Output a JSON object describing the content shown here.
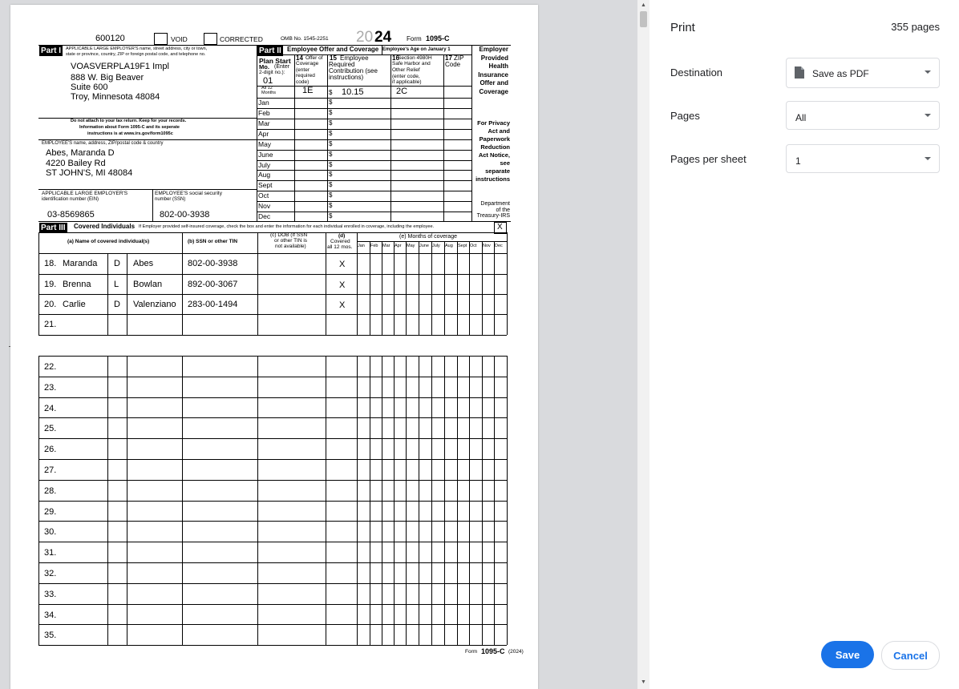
{
  "form": {
    "control_no": "600120",
    "void_label": "VOID",
    "corrected_label": "CORRECTED",
    "omb": "OMB No. 1545-2251",
    "year_prefix": "20",
    "year_suffix": "24",
    "form_label": "Form",
    "form_name": "1095-C",
    "part1_label": "Part I",
    "employer_header": "APPLICABLE LARGE EMPLOYER'S name, street address, city or town,",
    "employer_header2": "state or province, country, ZIP or foreign postal code, and telephone no.",
    "employer_name": "VOASVERPLA19F1 Impl",
    "employer_street": "888 W. Big Beaver",
    "employer_suite": "Suite 600",
    "employer_city": "Troy, Minnesota 48084",
    "notice1": "Do not attach to your tax return. Keep for your records.",
    "notice2": "Information about Form 1095-C and its seperate",
    "notice3": "instructions is at www.irs.gov/form1095c",
    "employee_header": "EMPLOYEE'S name, address, ZIP/postal code & country",
    "employee_name": "Abes, Maranda D",
    "employee_street": "4220 Bailey Rd",
    "employee_city": "ST JOHN'S, MI 48084",
    "ein_header1": "APPLICABLE LARGE EMPLOYER'S",
    "ein_header2": "identification number (EIN)",
    "ein": "03-8569865",
    "ssn_header1": "EMPLOYEE'S social security",
    "ssn_header2": "number (SSN)",
    "ssn": "802-00-3938",
    "part2_label": "Part II",
    "part2_title": "Employee Offer and Coverage",
    "age_label": "Employee's Age on January 1",
    "plan_start_1": "Plan Start",
    "plan_start_2": "Mo.",
    "plan_start_3": "(Enter",
    "plan_start_4": "2-digit no.):",
    "plan_start_value": "01",
    "col14_1": "14",
    "col14_2": "Offer of",
    "col14_3": "Coverage",
    "col14_4": "(enter",
    "col14_5": "required",
    "col14_6": "code)",
    "col15_1": "15",
    "col15_2": "Employee",
    "col15_3": "Required",
    "col15_4": "Contribution (see",
    "col15_5": "instructions)",
    "col16_1": "16",
    "col16_2": "Section 4980H",
    "col16_3": "Safe Harbor and",
    "col16_4": "Other Relief",
    "col16_5": "(enter code,",
    "col16_6": "if applicable)",
    "col17_1": "17",
    "col17_2": "ZIP",
    "col17_3": "Code",
    "all12_1": "All 12",
    "all12_2": "Months",
    "all12_offer": "1E",
    "dollar": "$",
    "all12_contribution": "10.15",
    "all12_safe_harbor": "2C",
    "months": [
      "Jan",
      "Feb",
      "Mar",
      "Apr",
      "May",
      "June",
      "July",
      "Aug",
      "Sept",
      "Oct",
      "Nov",
      "Dec"
    ],
    "side1": [
      "Employer",
      "Provided",
      "Health",
      "Insurance",
      "Offer and",
      "Coverage"
    ],
    "side2": [
      "For Privacy",
      "Act and",
      "Paperwork",
      "Reduction",
      "Act Notice,",
      "see",
      "separate",
      "instructions"
    ],
    "side3": [
      "Department",
      "of the",
      "Treasury-IRS"
    ],
    "part3_label": "Part III",
    "part3_title": "Covered Individuals",
    "part3_note": "If Employer provided self-insured coverage, check the box and enter the information for each individual enrolled in coverage, including the employee.",
    "part3_check": "X",
    "col_a": "(a) Name of covered individual(s)",
    "col_b": "(b) SSN or other TIN",
    "col_c1": "(c) DOB (If SSN",
    "col_c2": "or other TIN is",
    "col_c3": "not available)",
    "col_d1": "(d)",
    "col_d2": "Covered",
    "col_d3": "all 12 mos.",
    "col_e": "(e) Months of coverage",
    "months_short": [
      "Jan",
      "Feb",
      "Mar",
      "Apr",
      "May",
      "June",
      "July",
      "Aug",
      "Sept",
      "Oct",
      "Nov",
      "Dec"
    ],
    "covered": [
      {
        "num": "18.",
        "first": "Maranda",
        "mi": "D",
        "last": "Abes",
        "ssn": "802-00-3938",
        "all12": "X"
      },
      {
        "num": "19.",
        "first": "Brenna",
        "mi": "L",
        "last": "Bowlan",
        "ssn": "892-00-3067",
        "all12": "X"
      },
      {
        "num": "20.",
        "first": "Carlie",
        "mi": "D",
        "last": "Valenziano",
        "ssn": "283-00-1494",
        "all12": "X"
      },
      {
        "num": "21.",
        "first": "",
        "mi": "",
        "last": "",
        "ssn": "",
        "all12": ""
      }
    ],
    "rows2": [
      "22.",
      "23.",
      "24.",
      "25.",
      "26.",
      "27.",
      "28.",
      "29.",
      "30.",
      "31.",
      "32.",
      "33.",
      "34.",
      "35."
    ],
    "footer_form": "Form",
    "footer_name": "1095-C",
    "footer_year": "(2024)"
  },
  "print_panel": {
    "title": "Print",
    "page_count": "355 pages",
    "destination_label": "Destination",
    "destination_value": "Save as PDF",
    "destination_icon": "document-icon",
    "pages_label": "Pages",
    "pages_value": "All",
    "pps_label": "Pages per sheet",
    "pps_value": "1",
    "save_label": "Save",
    "cancel_label": "Cancel"
  }
}
